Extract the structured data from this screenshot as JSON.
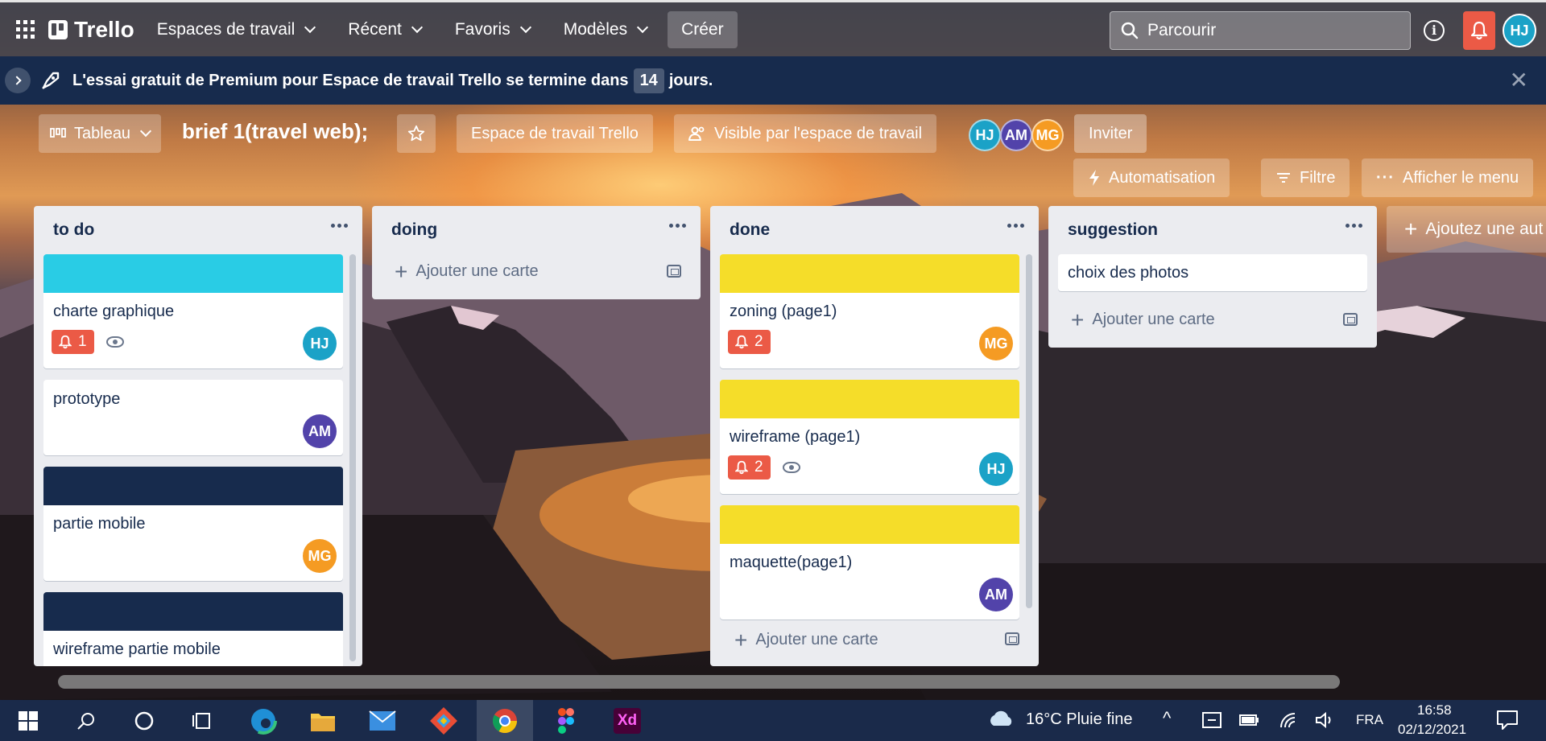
{
  "topbar": {
    "logo": "Trello",
    "nav": [
      "Espaces de travail",
      "Récent",
      "Favoris",
      "Modèles"
    ],
    "create": "Créer",
    "search_placeholder": "Parcourir",
    "user_initials": "HJ"
  },
  "banner": {
    "text_before": "L'essai gratuit de Premium pour Espace de travail Trello se termine dans",
    "days": "14",
    "text_after": "jours."
  },
  "board": {
    "view": "Tableau",
    "title": "brief 1(travel web);",
    "workspace": "Espace de travail Trello",
    "visibility": "Visible par l'espace de travail",
    "members": [
      "HJ",
      "AM",
      "MG"
    ],
    "invite": "Inviter",
    "automation": "Automatisation",
    "filter": "Filtre",
    "menu": "Afficher le menu",
    "add_list": "Ajoutez une aut"
  },
  "lists": [
    {
      "title": "to do",
      "cards": [
        {
          "title": "charte graphique",
          "cover": "#29cce5",
          "notifications": "1",
          "watching": true,
          "member": "HJ"
        },
        {
          "title": "prototype",
          "member": "AM"
        },
        {
          "title": "partie mobile",
          "cover": "#172b4d",
          "member": "MG"
        },
        {
          "title": "wireframe partie mobile",
          "cover": "#172b4d"
        }
      ]
    },
    {
      "title": "doing",
      "cards": [],
      "add_card": "Ajouter une carte"
    },
    {
      "title": "done",
      "cards": [
        {
          "title": "zoning (page1)",
          "cover": "#f5dd29",
          "notifications": "2",
          "member": "MG"
        },
        {
          "title": "wireframe (page1)",
          "cover": "#f5dd29",
          "notifications": "2",
          "watching": true,
          "member": "HJ"
        },
        {
          "title": "maquette(page1)",
          "cover": "#f5dd29",
          "member": "AM"
        }
      ],
      "add_card": "Ajouter une carte"
    },
    {
      "title": "suggestion",
      "cards": [
        {
          "title": "choix des photos"
        }
      ],
      "add_card": "Ajouter une carte"
    }
  ],
  "taskbar": {
    "weather": "16°C  Pluie fine",
    "language": "FRA",
    "time": "16:58",
    "date": "02/12/2021"
  },
  "colors": {
    "hj": "#1ba2c7",
    "am": "#5243aa",
    "mg": "#f59b23",
    "notification": "#eb5a46",
    "banner": "#172b4d"
  }
}
